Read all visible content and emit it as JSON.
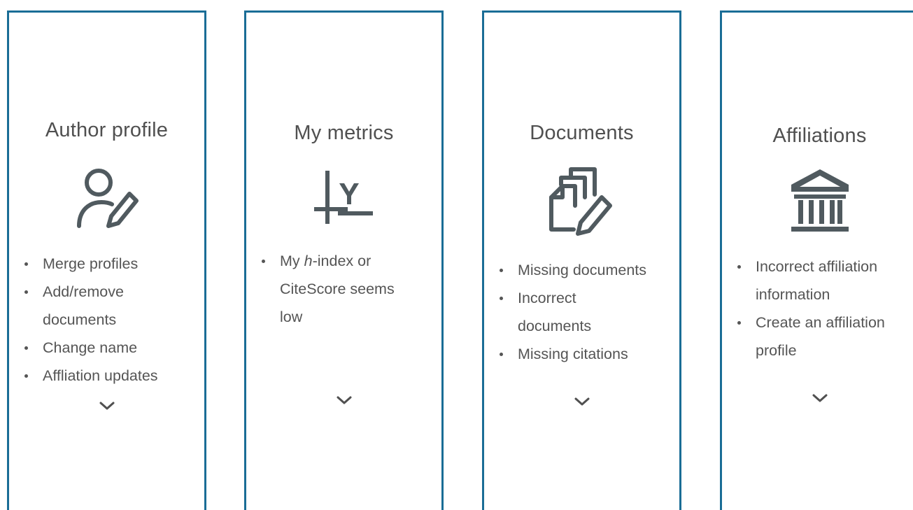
{
  "colors": {
    "card_border": "#1a6d96",
    "text": "#505050",
    "icon": "#505a5f"
  },
  "cards": [
    {
      "title": "Author profile",
      "icon": "user-edit-icon",
      "items": [
        "Merge profiles",
        "Add/remove documents",
        "Change name",
        "Affliation updates"
      ]
    },
    {
      "title": "My metrics",
      "icon": "metrics-icon",
      "items_rich": {
        "prefix": "My ",
        "emphasis": "h",
        "suffix": "-index or CiteScore seems low"
      }
    },
    {
      "title": "Documents",
      "icon": "documents-edit-icon",
      "items": [
        "Missing documents",
        "Incorrect documents",
        "Missing citations"
      ]
    },
    {
      "title": "Affiliations",
      "icon": "institution-icon",
      "items": [
        "Incorrect affiliation information",
        "Create an affiliation profile"
      ]
    }
  ]
}
